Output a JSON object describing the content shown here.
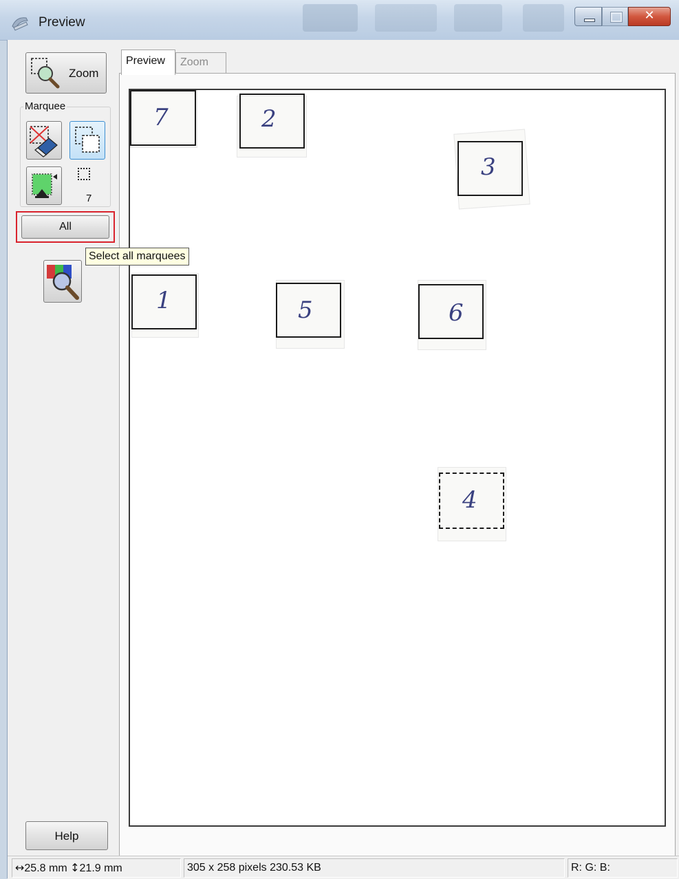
{
  "window": {
    "title": "Preview"
  },
  "toolbar": {
    "zoom_label": "Zoom",
    "marquee_group_label": "Marquee",
    "marquee_count": "7",
    "all_label": "All",
    "all_tooltip": "Select all marquees",
    "help_label": "Help"
  },
  "tabs": [
    {
      "label": "Preview",
      "active": true
    },
    {
      "label": "Zoom",
      "active": false
    }
  ],
  "preview": {
    "marquees": [
      {
        "label": "7",
        "style": "solid"
      },
      {
        "label": "2",
        "style": "solid"
      },
      {
        "label": "3",
        "style": "solid"
      },
      {
        "label": "1",
        "style": "solid"
      },
      {
        "label": "5",
        "style": "solid"
      },
      {
        "label": "6",
        "style": "solid"
      },
      {
        "label": "4",
        "style": "dashed"
      }
    ]
  },
  "status": {
    "width_value": "25.8 mm",
    "height_value": "21.9 mm",
    "image_info": "305 x 258 pixels 230.53 KB",
    "rgb_label": "R: G: B:"
  },
  "colors": {
    "highlight_frame": "#d9232d",
    "tooltip_bg": "#ffffe1"
  }
}
